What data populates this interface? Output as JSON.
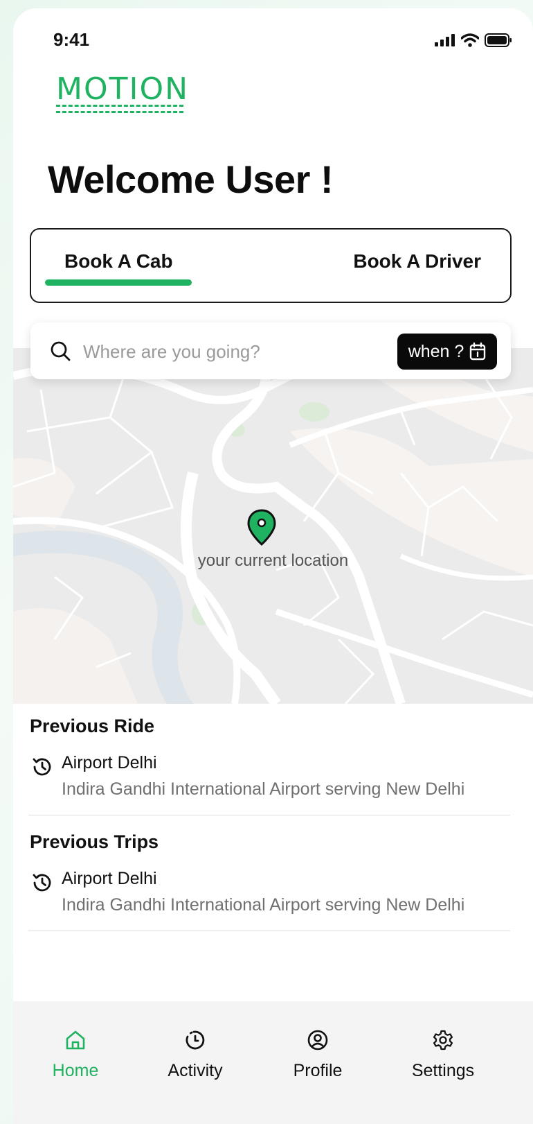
{
  "status": {
    "time": "9:41"
  },
  "logo": {
    "text": "MOTION"
  },
  "welcome": {
    "title": "Welcome User !"
  },
  "tabs": [
    {
      "label": "Book A Cab",
      "active": true
    },
    {
      "label": "Book A Driver",
      "active": false
    }
  ],
  "search": {
    "placeholder": "Where are you going?",
    "when_label": "when ?"
  },
  "map": {
    "pin_label": "your current location"
  },
  "previous_ride": {
    "title": "Previous Ride",
    "item": {
      "title": "Airport Delhi",
      "subtitle": "Indira Gandhi International Airport serving New Delhi"
    }
  },
  "previous_trips": {
    "title": "Previous Trips",
    "item": {
      "title": "Airport Delhi",
      "subtitle": "Indira Gandhi International Airport serving New Delhi"
    }
  },
  "nav": [
    {
      "label": "Home",
      "icon": "home-icon",
      "active": true
    },
    {
      "label": "Activity",
      "icon": "activity-icon",
      "active": false
    },
    {
      "label": "Profile",
      "icon": "profile-icon",
      "active": false
    },
    {
      "label": "Settings",
      "icon": "settings-icon",
      "active": false
    }
  ],
  "colors": {
    "accent": "#1fb260",
    "dark": "#0a0a0a",
    "nav_bg": "#f4f4f4"
  }
}
